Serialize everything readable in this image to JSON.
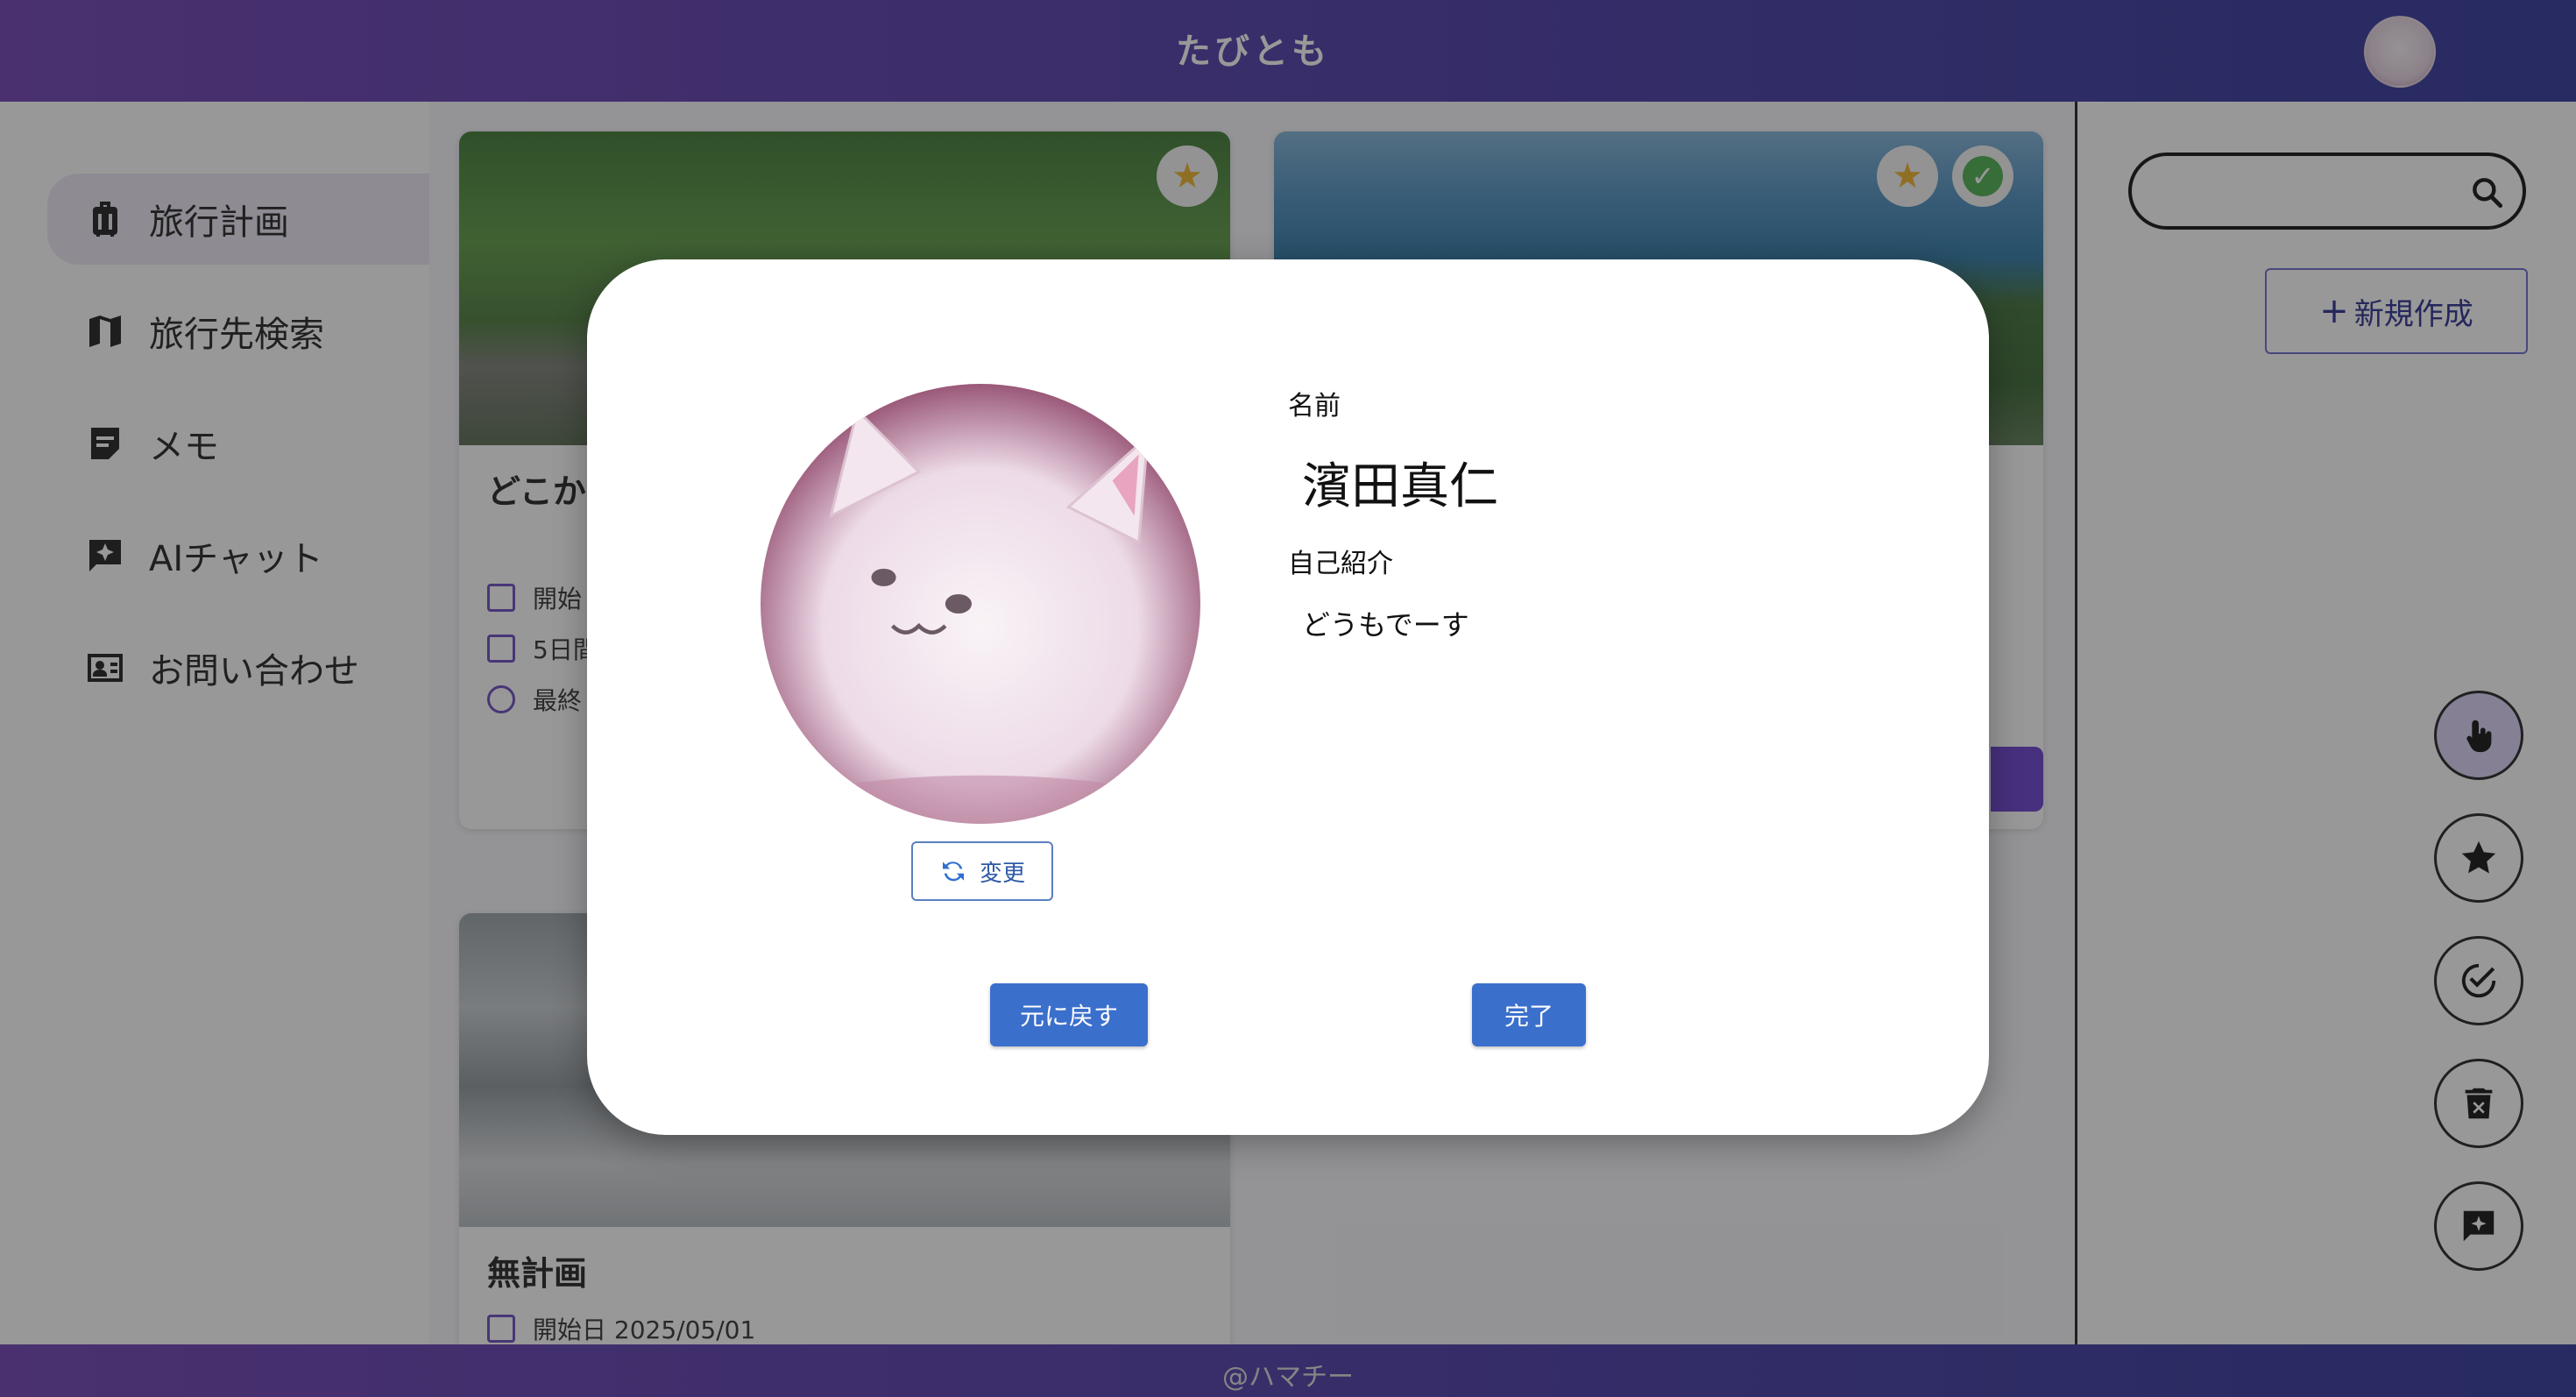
{
  "header": {
    "title": "たびとも",
    "avatar_icon": "cat-avatar"
  },
  "sidebar": {
    "items": [
      {
        "label": "旅行計画",
        "icon": "luggage-icon",
        "active": true
      },
      {
        "label": "旅行先検索",
        "icon": "map-icon",
        "active": false
      },
      {
        "label": "メモ",
        "icon": "note-icon",
        "active": false
      },
      {
        "label": "AIチャット",
        "icon": "ai-chat-icon",
        "active": false
      },
      {
        "label": "お問い合わせ",
        "icon": "contact-card-icon",
        "active": false
      }
    ]
  },
  "main": {
    "cards": [
      {
        "title": "どこか",
        "meta": [
          "開始",
          "5日間",
          "最終"
        ],
        "badges": [
          "star"
        ]
      },
      {
        "title": "",
        "meta": [],
        "badges": [
          "star",
          "check"
        ]
      },
      {
        "title": "無計画",
        "meta": [
          "開始日 2025/05/01"
        ],
        "badges": []
      }
    ]
  },
  "right_panel": {
    "search": {
      "value": "",
      "placeholder": ""
    },
    "new_button": "新規作成",
    "new_icon": "plus-icon",
    "fabs": [
      "touch-icon",
      "star-icon",
      "check-circle-icon",
      "trash-icon",
      "chat-add-icon"
    ]
  },
  "footer": {
    "text": "@ハマチー"
  },
  "profile_modal": {
    "name_label": "名前",
    "name": "濱田真仁",
    "intro_label": "自己紹介",
    "intro": "どうもでーす",
    "change_button": "変更",
    "revert_button": "元に戻す",
    "done_button": "完了"
  },
  "colors": {
    "header_gradient_start": "#6f3fb4",
    "header_gradient_end": "#2f3699",
    "primary_button": "#3b6fcc",
    "accent": "#6a3fd0",
    "star": "#f0b429",
    "check": "#4caf50"
  }
}
